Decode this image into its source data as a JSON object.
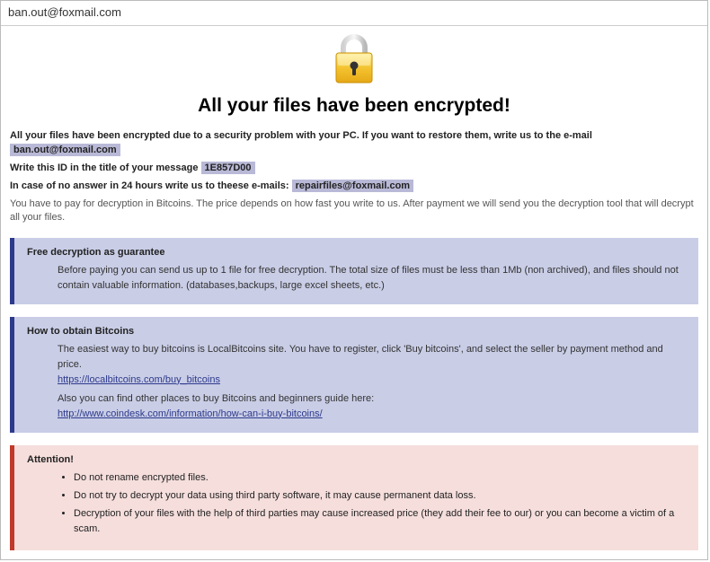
{
  "window": {
    "title": "ban.out@foxmail.com"
  },
  "lock": {
    "name": "lock-icon"
  },
  "heading": "All your files have been encrypted!",
  "intro": {
    "line1_a": "All your files have been encrypted due to a security problem with your PC. If you want to restore them, write us to the e-mail ",
    "email1": "ban.out@foxmail.com",
    "line2_a": "Write this ID in the title of your message ",
    "id": "1E857D00",
    "line3_a": "In case of no answer in 24 hours write us to theese e-mails: ",
    "email2": "repairfiles@foxmail.com",
    "pay": "You have to pay for decryption in Bitcoins. The price depends on how fast you write to us. After payment we will send you the decryption tool that will decrypt all your files."
  },
  "panels": {
    "free": {
      "title": "Free decryption as guarantee",
      "body": "Before paying you can send us up to 1 file for free decryption. The total size of files must be less than 1Mb (non archived), and files should not contain valuable information. (databases,backups, large excel sheets, etc.)"
    },
    "obtain": {
      "title": "How to obtain Bitcoins",
      "l1": "The easiest way to buy bitcoins is LocalBitcoins site. You have to register, click 'Buy bitcoins', and select the seller by payment method and price.",
      "link1": "https://localbitcoins.com/buy_bitcoins",
      "l2": "Also you can find other places to buy Bitcoins and beginners guide here:",
      "link2": "http://www.coindesk.com/information/how-can-i-buy-bitcoins/"
    },
    "attn": {
      "title": "Attention!",
      "b1": "Do not rename encrypted files.",
      "b2": "Do not try to decrypt your data using third party software, it may cause permanent data loss.",
      "b3": "Decryption of your files with the help of third parties may cause increased price (they add their fee to our) or you can become a victim of a scam."
    }
  }
}
